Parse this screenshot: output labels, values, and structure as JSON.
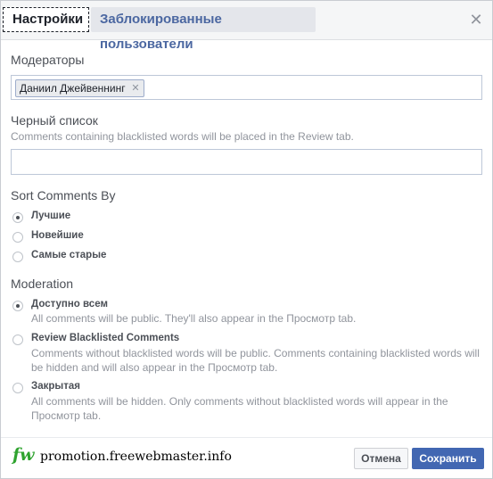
{
  "tabs": [
    {
      "label": "Настройки",
      "active": true
    },
    {
      "label": "Заблокированные пользователи",
      "active": false
    }
  ],
  "close_icon": "close-icon",
  "moderators": {
    "title": "Модераторы",
    "tokens": [
      "Даниил Джейвеннинг"
    ]
  },
  "blacklist": {
    "title": "Черный список",
    "hint": "Comments containing blacklisted words will be placed in the Review tab.",
    "value": ""
  },
  "sort": {
    "title": "Sort Comments By",
    "options": [
      {
        "label": "Лучшие",
        "checked": true
      },
      {
        "label": "Новейшие",
        "checked": false
      },
      {
        "label": "Самые старые",
        "checked": false
      }
    ]
  },
  "moderation": {
    "title": "Moderation",
    "options": [
      {
        "label": "Доступно всем",
        "checked": true,
        "desc": "All comments will be public. They'll also appear in the Просмотр tab."
      },
      {
        "label": "Review Blacklisted Comments",
        "checked": false,
        "desc": "Comments without blacklisted words will be public. Comments containing blacklisted words will be hidden and will also appear in the Просмотр tab."
      },
      {
        "label": "Закрытая",
        "checked": false,
        "desc": "All comments will be hidden. Only comments without blacklisted words will appear in the Просмотр tab."
      }
    ]
  },
  "footer": {
    "logo_mark": "fw",
    "logo_text": "promotion.freewebmaster.info",
    "cancel_label": "Отмена",
    "save_label": "Сохранить"
  },
  "colors": {
    "brand_blue": "#4267b2",
    "tab_inactive_text": "#4b67a1",
    "logo_green": "#2fa32f"
  }
}
